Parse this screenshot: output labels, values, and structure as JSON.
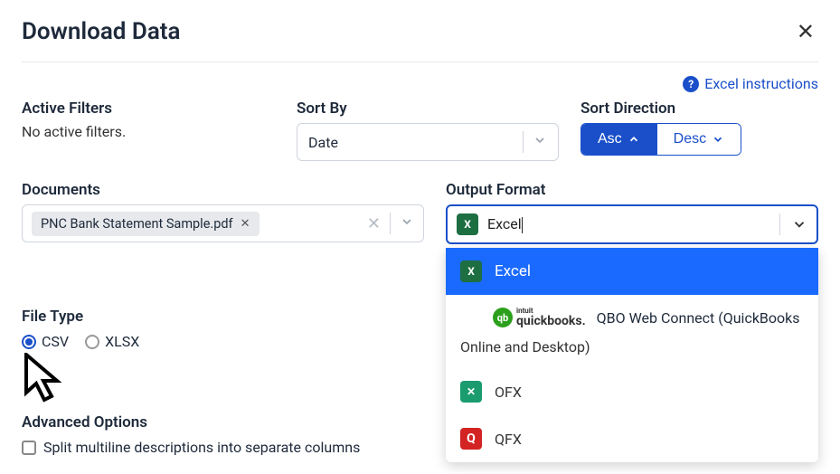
{
  "header": {
    "title": "Download Data"
  },
  "help": {
    "label": "Excel instructions"
  },
  "filters": {
    "label": "Active Filters",
    "value": "No active filters."
  },
  "sort_by": {
    "label": "Sort By",
    "value": "Date"
  },
  "sort_direction": {
    "label": "Sort Direction",
    "asc": "Asc",
    "desc": "Desc"
  },
  "documents": {
    "label": "Documents",
    "chip": "PNC Bank Statement Sample.pdf"
  },
  "output": {
    "label": "Output Format",
    "value": "Excel",
    "options": {
      "excel": "Excel",
      "qbo": "QBO Web Connect (QuickBooks Online and Desktop)",
      "qbo_sub": "Online and Desktop)",
      "qbo_top": "QBO Web Connect (QuickBooks",
      "ofx": "OFX",
      "qfx": "QFX"
    },
    "qb_brand": {
      "intuit": "intuit",
      "name": "quickbooks."
    }
  },
  "file_type": {
    "label": "File Type",
    "csv": "CSV",
    "xlsx": "XLSX"
  },
  "advanced": {
    "label": "Advanced Options",
    "split": "Split multiline descriptions into separate columns"
  }
}
